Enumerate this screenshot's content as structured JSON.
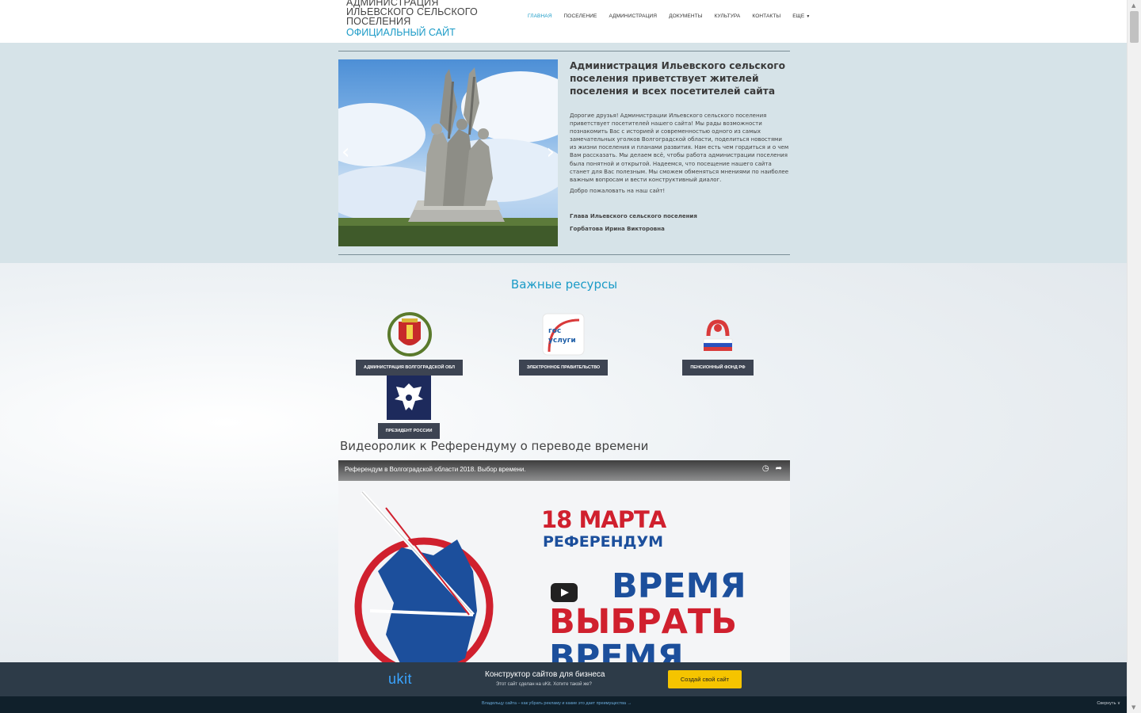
{
  "header": {
    "logo_line1": "АДМИНИСТРАЦИЯ",
    "logo_line2": "ИЛЬЕВСКОГО СЕЛЬСКОГО",
    "logo_line3": "ПОСЕЛЕНИЯ",
    "logo_subtitle": "ОФИЦИАЛЬНЫЙ САЙТ",
    "nav": [
      {
        "label": "Главная",
        "active": true
      },
      {
        "label": "Поселение"
      },
      {
        "label": "Администрация"
      },
      {
        "label": "Документы"
      },
      {
        "label": "Культура"
      },
      {
        "label": "Контакты"
      },
      {
        "label": "Еще"
      }
    ],
    "accent_color": "#1b9bc7"
  },
  "hero": {
    "title": "Администрация Ильевского сельского поселения приветствует жителей поселения и всех посетителей сайта",
    "body": "Дорогие друзья! Администрации Ильевского сельского поселения приветствует посетителей нашего сайта! Мы рады возможности познакомить Вас с историей и современностью одного из самых замечательных уголков Волгоградской области, поделиться новостями из жизни поселения и планами развития. Нам есть чем гордиться и о чем Вам рассказать. Мы делаем всё, чтобы работа администрации поселения была понятной и открытой. Надеемся, что посещение нашего сайта станет для Вас полезным. Мы сможем обменяться мнениями по наиболее важным вопросам и вести конструктивный диалог.",
    "welcome": "Добро пожаловать на наш сайт!",
    "signature_role": "Глава Ильевского сельского поселения",
    "signature_name": "Горбатова Ирина Викторовна",
    "slider_prev_icon": "chevron-left-icon",
    "slider_next_icon": "chevron-right-icon"
  },
  "resources": {
    "title": "Важные ресурсы",
    "items": [
      {
        "label": "Администрация Волгоградской обл",
        "icon": "volgograd-coat-of-arms-icon"
      },
      {
        "label": "Электронное правительство",
        "icon": "gosuslugi-logo-icon",
        "logo_text_1": "гос",
        "logo_text_2": "услуги"
      },
      {
        "label": "Пенсионный фонд РФ",
        "icon": "pension-fund-logo-icon"
      },
      {
        "label": "Президент России",
        "icon": "russian-eagle-icon"
      }
    ]
  },
  "video": {
    "heading": "Видеоролик к Референдуму о переводе времени",
    "title": "Референдум в Волгоградской области 2018. Выбор времени.",
    "thumb_date": "18 МАРТА",
    "thumb_ref": "РЕФЕРЕНДУМ",
    "thumb_word1": "ВРЕМЯ",
    "thumb_word2": "ВЫБРАТЬ",
    "thumb_word3": "ВРЕМЯ"
  },
  "ukit_banner": {
    "logo": "ukit",
    "title": "Конструктор сайтов для бизнеса",
    "subtitle": "Этот сайт сделан на uKit. Хотите такой же?",
    "button": "Создай свой сайт",
    "footer_link": "Владельцу сайта – как убрать рекламу и какие это дает преимущества →",
    "collapse": "Свернуть ∨"
  }
}
